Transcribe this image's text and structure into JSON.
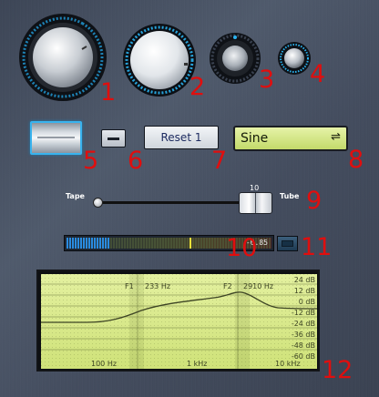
{
  "labels": {
    "n1": "1",
    "n2": "2",
    "n3": "3",
    "n4": "4",
    "n5": "5",
    "n6": "6",
    "n7": "7",
    "n8": "8",
    "n9": "9",
    "n10": "10",
    "n11": "11",
    "n12": "12"
  },
  "reset_button": {
    "label": "Reset 1"
  },
  "selector": {
    "value": "Sine",
    "icon": "swap-arrows-icon"
  },
  "slider": {
    "left_label": "Tape",
    "right_label": "Tube",
    "value": "10",
    "position_fraction": 0.88
  },
  "meter": {
    "readout": "-6.85",
    "level_fraction": 0.2,
    "peak_fraction": 0.6
  },
  "eq": {
    "markers": [
      {
        "name": "F1",
        "freq": "233 Hz"
      },
      {
        "name": "F2",
        "freq": "2910 Hz"
      }
    ],
    "db_labels": [
      "24 dB",
      "12 dB",
      "0 dB",
      "-12 dB",
      "-24 dB",
      "-36 dB",
      "-48 dB",
      "-60 dB"
    ],
    "freq_labels": [
      "100 Hz",
      "1 kHz",
      "10 kHz"
    ]
  },
  "colors": {
    "accent": "#39b3ee",
    "label_red": "#e00e0e",
    "lcd": "#d6e98a"
  }
}
